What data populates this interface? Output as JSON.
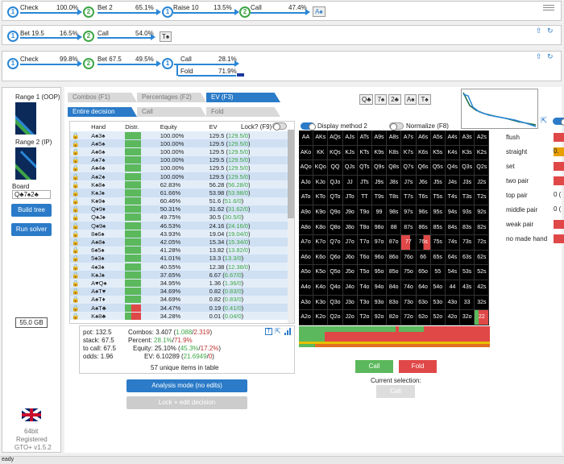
{
  "tree_rows": [
    {
      "nodes": [
        {
          "label": "1",
          "type": "b"
        },
        {
          "label": "2",
          "type": "g"
        },
        {
          "label": "1",
          "type": "b"
        },
        {
          "label": "2",
          "type": "g"
        }
      ],
      "actions": [
        {
          "name": "Check",
          "pct": "100.0%"
        },
        {
          "name": "Bet 2",
          "pct": "65.1%"
        },
        {
          "name": "Raise 10",
          "pct": "13.5%"
        },
        {
          "name": "Call",
          "pct": "47.4%"
        }
      ],
      "board_chip": "A♠"
    },
    {
      "nodes": [
        {
          "label": "1",
          "type": "b"
        },
        {
          "label": "2",
          "type": "g"
        }
      ],
      "actions": [
        {
          "name": "Bet 19.5",
          "pct": "16.5%"
        },
        {
          "name": "Call",
          "pct": "54.0%"
        }
      ],
      "board_chip": "T♠"
    },
    {
      "nodes": [
        {
          "label": "1",
          "type": "b"
        },
        {
          "label": "2",
          "type": "g"
        },
        {
          "label": "1",
          "type": "b"
        }
      ],
      "actions": [
        {
          "name": "Check",
          "pct": "99.8%"
        },
        {
          "name": "Bet 67.5",
          "pct": "49.5%"
        }
      ],
      "final": [
        {
          "name": "Call",
          "pct": "28.1%"
        },
        {
          "name": "Fold",
          "pct": "71.9%"
        }
      ]
    }
  ],
  "left": {
    "range1": "Range 1 (OOP)",
    "range2": "Range 2 (IP)",
    "board_label": "Board",
    "board_value": "Q♣7♠2♣",
    "build_tree": "Build tree",
    "run_solver": "Run solver",
    "memory": "55.0 GB",
    "version1": "64bit",
    "version2": "Registered",
    "version3": "GTO+ v1.5.2"
  },
  "tabs": {
    "t1": "Combos (F1)",
    "t2": "Percentages (F2)",
    "t3": "EV (F3)",
    "t4": "Entire decision",
    "t5": "Call",
    "t6": "Fold"
  },
  "board_cards": [
    "Q♣",
    "7♠",
    "2♣",
    "A♠",
    "T♠"
  ],
  "table": {
    "h_hand": "Hand",
    "h_distr": "Distr.",
    "h_equity": "Equity",
    "h_ev": "EV",
    "lock": "Lock? (F9)",
    "rows": [
      [
        "A♠3♠",
        "100.00%",
        "129.5",
        "129.5/0"
      ],
      [
        "A♠5♠",
        "100.00%",
        "129.5",
        "129.5/0"
      ],
      [
        "A♠6♠",
        "100.00%",
        "129.5",
        "129.5/0"
      ],
      [
        "A♠7♠",
        "100.00%",
        "129.5",
        "129.5/0"
      ],
      [
        "A♠4♠",
        "100.00%",
        "129.5",
        "129.5/0"
      ],
      [
        "A♠2♠",
        "100.00%",
        "129.5",
        "129.5/0"
      ],
      [
        "K♠8♠",
        "62.83%",
        "56.28",
        "56.28/0"
      ],
      [
        "K♠J♠",
        "61.66%",
        "53.98",
        "53.98/0"
      ],
      [
        "K♠9♠",
        "60.46%",
        "51.6",
        "51.6/0"
      ],
      [
        "Q♦9♦",
        "50.31%",
        "31.62",
        "31.62/0"
      ],
      [
        "Q♠J♠",
        "49.75%",
        "30.5",
        "30.5/0"
      ],
      [
        "Q♠9♠",
        "46.53%",
        "24.16",
        "24.16/0"
      ],
      [
        "8♠6♠",
        "43.93%",
        "19.04",
        "19.04/0"
      ],
      [
        "A♠8♠",
        "42.05%",
        "15.34",
        "15.34/0"
      ],
      [
        "6♠5♠",
        "41.28%",
        "13.82",
        "13.82/0"
      ],
      [
        "5♠3♠",
        "41.01%",
        "13.3",
        "13.3/0"
      ],
      [
        "4♠3♠",
        "40.55%",
        "12.38",
        "12.38/0"
      ],
      [
        "K♠J♠",
        "37.65%",
        "6.67",
        "6.67/0"
      ],
      [
        "A♥Q♠",
        "34.95%",
        "1.36",
        "1.36/0"
      ],
      [
        "A♠T♥",
        "34.69%",
        "0.82",
        "0.83/0"
      ],
      [
        "A♠T♦",
        "34.69%",
        "0.82",
        "0.83/0"
      ],
      [
        "A♠T♣",
        "34.47%",
        "0.19",
        "0.41/0"
      ],
      [
        "K♠8♣",
        "34.28%",
        "0.01",
        "0.04/0"
      ]
    ]
  },
  "stats": {
    "pot": "pot: 132.5",
    "stack": "stack: 67.5",
    "tocall": "to call: 67.5",
    "odds": "odds: 1.96",
    "combos_l": "Combos:",
    "combos_v": "3.407 (",
    "combos_a": "1.088",
    "combos_s": "/",
    "combos_b": "2.319",
    "combos_e": ")",
    "percent_l": "Percent:",
    "percent_a": "28.1%",
    "percent_s": "/",
    "percent_b": "71.9%",
    "equity_l": "Equity:",
    "equity_v": "25.10% (",
    "equity_a": "45.3%",
    "equity_b": "17.2%",
    "ev_l": "EV:",
    "ev_v": "6.10289 (",
    "ev_a": "21.6949",
    "ev_b": "0",
    "unique": "57 unique items in table"
  },
  "analysis_btn": "Analysis mode (no edits)",
  "lock_btn": "Lock + edit decision",
  "display_method": "Display method 2",
  "normalize": "Normalize (F8)",
  "grid": [
    "AA",
    "AKs",
    "AQs",
    "AJs",
    "ATs",
    "A9s",
    "A8s",
    "A7s",
    "A6s",
    "A5s",
    "A4s",
    "A3s",
    "A2s",
    "AKo",
    "KK",
    "KQs",
    "KJs",
    "KTs",
    "K9s",
    "K8s",
    "K7s",
    "K6s",
    "K5s",
    "K4s",
    "K3s",
    "K2s",
    "AQo",
    "KQo",
    "QQ",
    "QJs",
    "QTs",
    "Q9s",
    "Q8s",
    "Q7s",
    "Q6s",
    "Q5s",
    "Q4s",
    "Q3s",
    "Q2s",
    "AJo",
    "KJo",
    "QJo",
    "JJ",
    "JTs",
    "J9s",
    "J8s",
    "J7s",
    "J6s",
    "J5s",
    "J4s",
    "J3s",
    "J2s",
    "ATo",
    "KTo",
    "QTo",
    "JTo",
    "TT",
    "T9s",
    "T8s",
    "T7s",
    "T6s",
    "T5s",
    "T4s",
    "T3s",
    "T2s",
    "A9o",
    "K9o",
    "Q9o",
    "J9o",
    "T9o",
    "99",
    "98s",
    "97s",
    "96s",
    "95s",
    "94s",
    "93s",
    "92s",
    "A8o",
    "K8o",
    "Q8o",
    "J8o",
    "T8o",
    "98o",
    "88",
    "87s",
    "86s",
    "85s",
    "84s",
    "83s",
    "82s",
    "A7o",
    "K7o",
    "Q7o",
    "J7o",
    "T7o",
    "97o",
    "87o",
    "77",
    "76s",
    "75s",
    "74s",
    "73s",
    "72s",
    "A6o",
    "K6o",
    "Q6o",
    "J6o",
    "T6o",
    "96o",
    "86o",
    "76o",
    "66",
    "65s",
    "64s",
    "63s",
    "62s",
    "A5o",
    "K5o",
    "Q5o",
    "J5o",
    "T5o",
    "95o",
    "85o",
    "75o",
    "65o",
    "55",
    "54s",
    "53s",
    "52s",
    "A4o",
    "K4o",
    "Q4o",
    "J4o",
    "T4o",
    "94o",
    "84o",
    "74o",
    "64o",
    "54o",
    "44",
    "43s",
    "42s",
    "A3o",
    "K3o",
    "Q3o",
    "J3o",
    "T3o",
    "93o",
    "83o",
    "73o",
    "63o",
    "53o",
    "43o",
    "33",
    "32s",
    "A2o",
    "K2o",
    "Q2o",
    "J2o",
    "T2o",
    "92o",
    "82o",
    "72o",
    "62o",
    "52o",
    "42o",
    "32o",
    "22"
  ],
  "call_btn": "Call",
  "fold_btn": "Fold",
  "current_sel": "Current selection:",
  "current_btn": "Call",
  "categories": [
    "flush",
    "straight",
    "set",
    "two pair",
    "top pair",
    "middle pair",
    "weak pair",
    "no made hand"
  ],
  "cat_values": [
    "",
    "0.",
    "",
    "",
    "0 (",
    "0 (",
    "",
    ""
  ],
  "colors": {
    "accent": "#2b7bc8",
    "call": "#5cb85c",
    "fold": "#e04848"
  }
}
